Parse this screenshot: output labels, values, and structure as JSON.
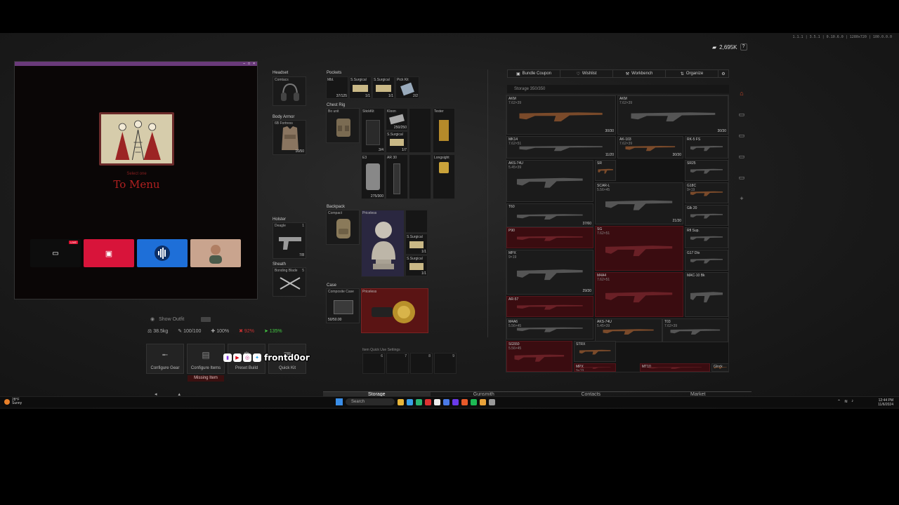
{
  "topbar": {
    "info": "1.1.1 | 3.5.1 | 0.10.6.0 | 1280x720 | 100.0.0.0"
  },
  "currency": {
    "amount": "2,695K",
    "help": "?"
  },
  "overlay": {
    "menu_sub": "Select one",
    "menu_title": "To Menu",
    "live_badge": "LIVE",
    "tiles": [
      "stream",
      "media",
      "audio",
      "avatar"
    ]
  },
  "equipment": {
    "headset": {
      "label": "Headset",
      "item": "Comtacs"
    },
    "body_armor": {
      "label": "Body Armor",
      "item": "6B Fortress",
      "count": "16/50"
    },
    "holster": {
      "label": "Holster",
      "item": "Deagle",
      "count": "1",
      "ammo": "7/8"
    },
    "sheath": {
      "label": "Sheath",
      "item": "Bonding Blade",
      "count": "5"
    },
    "pockets": {
      "label": "Pockets",
      "items": [
        {
          "label": "Mbl.",
          "count": "37/125"
        },
        {
          "label": "S.Surgical",
          "count": "1/1"
        },
        {
          "label": "S.Surgical",
          "count": "1/1"
        },
        {
          "label": "Pick Kit",
          "count": "2/2"
        }
      ]
    },
    "chest_rig": {
      "label": "Chest Rig",
      "item": "Bo unit",
      "cells": [
        {
          "label": "StickKit",
          "count": "3/4"
        },
        {
          "label": "Kloon",
          "count": "250/250"
        },
        {
          "label": "S.Surgical",
          "count": "1/7"
        },
        {
          "label": "Tester",
          "count": ""
        },
        {
          "label": "E3",
          "count": "275/300"
        },
        {
          "label": "AR 30",
          "count": ""
        },
        {
          "label": "Longsight",
          "count": ""
        }
      ]
    },
    "backpack": {
      "label": "Backpack",
      "item": "Compact",
      "items": [
        {
          "label": "Priceless",
          "count": ""
        },
        {
          "label": "S.Surgical",
          "count": "1/1"
        },
        {
          "label": "S.Surgical",
          "count": "1/1"
        }
      ]
    },
    "case": {
      "label": "Case",
      "item": "Composite Case",
      "meta": "50/50.00",
      "item2": "Priceless"
    }
  },
  "outfit": {
    "label": "Show Outfit"
  },
  "stats": {
    "weight": "38.5kg",
    "durability": "100/100",
    "health": "100%",
    "fire": "92%",
    "speed": "135%"
  },
  "actions": [
    {
      "label": "Configure Gear",
      "icon": "rifle-icon"
    },
    {
      "label": "Configure Items",
      "icon": "box-icon"
    },
    {
      "label": "Preset Build",
      "icon": "gear-icon"
    },
    {
      "label": "Quick Kit",
      "icon": "kit-icon"
    }
  ],
  "missing_item": "Missing Item",
  "stream": {
    "name": "frontd0or"
  },
  "quick_use": {
    "label": "Item Quick Use Settings",
    "slots": [
      "6",
      "7",
      "8",
      "9"
    ]
  },
  "stash": {
    "tabs": [
      {
        "label": "Bundle Coupon",
        "icon": "ticket-icon"
      },
      {
        "label": "Wishlist",
        "icon": "heart-icon"
      },
      {
        "label": "Workbench",
        "icon": "wrench-icon"
      },
      {
        "label": "Organize",
        "icon": "sort-icon"
      }
    ],
    "storage": "Storage 350/350",
    "items": [
      {
        "label": "AKM",
        "sub": "7.62×39",
        "count": "30/30",
        "red": false
      },
      {
        "label": "AKM",
        "sub": "7.62×39",
        "count": "30/30",
        "red": false
      },
      {
        "label": "MK14",
        "sub": "7.62×51",
        "count": "11/20",
        "red": false
      },
      {
        "label": "AK-103",
        "sub": "7.62×39",
        "count": "30/30",
        "red": false
      },
      {
        "label": "RK-5 FS",
        "sub": "",
        "count": "",
        "red": false
      },
      {
        "label": "AKS-74U",
        "sub": "5.45×39",
        "count": "",
        "red": false
      },
      {
        "label": "SR",
        "sub": "",
        "count": "",
        "red": false
      },
      {
        "label": "SR25",
        "sub": "",
        "count": "",
        "red": false
      },
      {
        "label": "SCAR-L",
        "sub": "5.56×45",
        "count": "21/30",
        "red": false
      },
      {
        "label": "G18C",
        "sub": "9×19",
        "count": "",
        "red": false
      },
      {
        "label": "T60",
        "sub": "",
        "count": "37/60",
        "red": false
      },
      {
        "label": "P90",
        "sub": "",
        "count": "",
        "red": true
      },
      {
        "label": "SG",
        "sub": "7.62×51",
        "count": "",
        "red": true
      },
      {
        "label": "Glk 20",
        "sub": "",
        "count": "",
        "red": false
      },
      {
        "label": "MPX",
        "sub": "9×19",
        "count": "29/30",
        "red": false
      },
      {
        "label": "M4A4",
        "sub": "7.62×51",
        "count": "",
        "red": true
      },
      {
        "label": "Rfl Sup.",
        "sub": "",
        "count": "",
        "red": false
      },
      {
        "label": "G17 Dtx",
        "sub": "",
        "count": "",
        "red": false
      },
      {
        "label": "AR-57",
        "sub": "",
        "count": "",
        "red": true
      },
      {
        "label": "MAC-10 Bk",
        "sub": "",
        "count": "",
        "red": false
      },
      {
        "label": "M4A6",
        "sub": "5.56×45",
        "count": "",
        "red": false
      },
      {
        "label": "AKS-74U",
        "sub": "5.45×39",
        "count": "",
        "red": false
      },
      {
        "label": "T03",
        "sub": "7.62×39",
        "count": "",
        "red": false
      },
      {
        "label": "SG550",
        "sub": "5.56×45",
        "count": "",
        "red": true
      },
      {
        "label": "STRX",
        "sub": "",
        "count": "",
        "red": false
      },
      {
        "label": "MPX",
        "sub": "9×19",
        "count": "",
        "red": true
      },
      {
        "label": "MT10",
        "sub": "",
        "count": "",
        "red": true
      },
      {
        "label": "Glock",
        "sub": "",
        "count": "",
        "red": false
      }
    ]
  },
  "bottom_tabs": [
    "Storage",
    "Gunsmith",
    "Contacts",
    "Market"
  ],
  "taskbar": {
    "weather_temp": "28°F",
    "weather_desc": "Sunny",
    "search": "Search",
    "time": "12:44 PM",
    "date": "11/6/2024"
  },
  "colors": {
    "accent_red": "#b02020",
    "overlay_bar": "#6a3a7a",
    "tile_red": "#d8143a",
    "tile_blue": "#1e6fd8"
  }
}
